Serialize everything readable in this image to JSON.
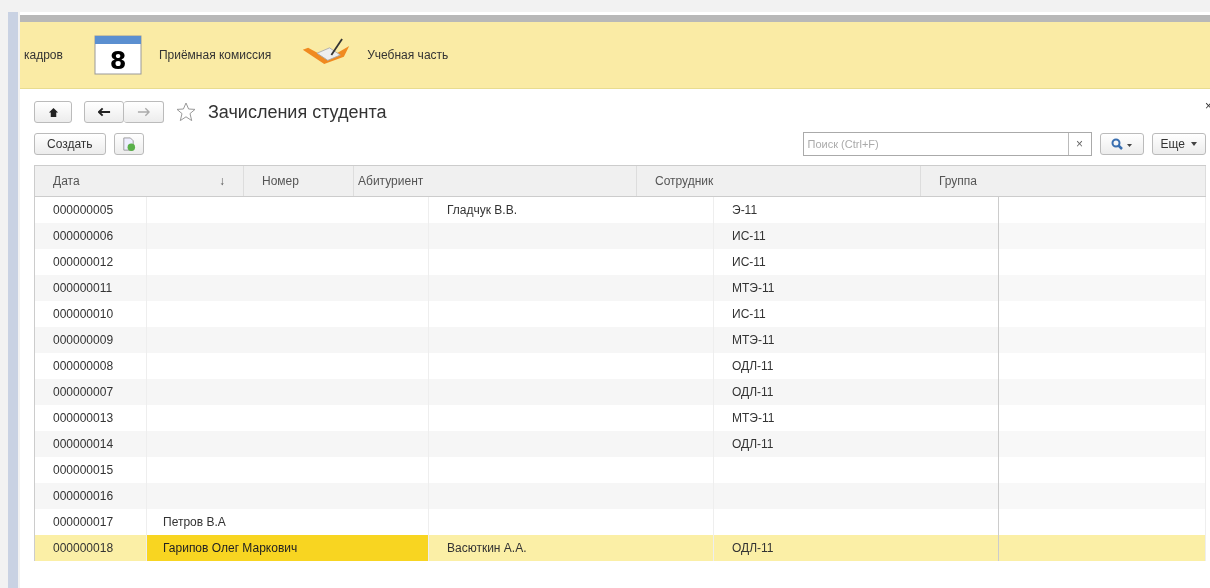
{
  "sections": [
    {
      "label": "кадров",
      "kind": "plain"
    },
    {
      "label": "Приёмная комиссия",
      "kind": "calendar",
      "icon_text": "8"
    },
    {
      "label": "Учебная часть",
      "kind": "folder"
    }
  ],
  "form": {
    "title": "Зачисления студента",
    "close": "×",
    "favorite": false,
    "create_button": "Создать",
    "search": {
      "placeholder": "Поиск (Ctrl+F)",
      "clear": "×"
    },
    "more_button": "Еще"
  },
  "table": {
    "columns": [
      {
        "label": "Дата",
        "sort": "↓"
      },
      {
        "label": "Номер"
      },
      {
        "label": "Абитуриент"
      },
      {
        "label": "Сотрудник"
      },
      {
        "label": "Группа"
      }
    ],
    "rows": [
      {
        "number": "000000005",
        "applicant": "",
        "employee": "Гладчук В.В.",
        "group": "Э-11",
        "selected": false
      },
      {
        "number": "000000006",
        "applicant": "",
        "employee": "",
        "group": "ИС-11",
        "selected": false
      },
      {
        "number": "000000012",
        "applicant": "",
        "employee": "",
        "group": "ИС-11",
        "selected": false
      },
      {
        "number": "000000011",
        "applicant": "",
        "employee": "",
        "group": "МТЭ-11",
        "selected": false
      },
      {
        "number": "000000010",
        "applicant": "",
        "employee": "",
        "group": "ИС-11",
        "selected": false
      },
      {
        "number": "000000009",
        "applicant": "",
        "employee": "",
        "group": "МТЭ-11",
        "selected": false
      },
      {
        "number": "000000008",
        "applicant": "",
        "employee": "",
        "group": "ОДЛ-11",
        "selected": false
      },
      {
        "number": "000000007",
        "applicant": "",
        "employee": "",
        "group": "ОДЛ-11",
        "selected": false
      },
      {
        "number": "000000013",
        "applicant": "",
        "employee": "",
        "group": "МТЭ-11",
        "selected": false
      },
      {
        "number": "000000014",
        "applicant": "",
        "employee": "",
        "group": "ОДЛ-11",
        "selected": false
      },
      {
        "number": "000000015",
        "applicant": "",
        "employee": "",
        "group": "",
        "selected": false
      },
      {
        "number": "000000016",
        "applicant": "",
        "employee": "",
        "group": "",
        "selected": false
      },
      {
        "number": "000000017",
        "applicant": "Петров В.А",
        "employee": "",
        "group": "",
        "selected": false
      },
      {
        "number": "000000018",
        "applicant": "Гарипов Олег Маркович",
        "employee": "Васюткин А.А.",
        "group": "ОДЛ-11",
        "selected": true
      }
    ]
  }
}
